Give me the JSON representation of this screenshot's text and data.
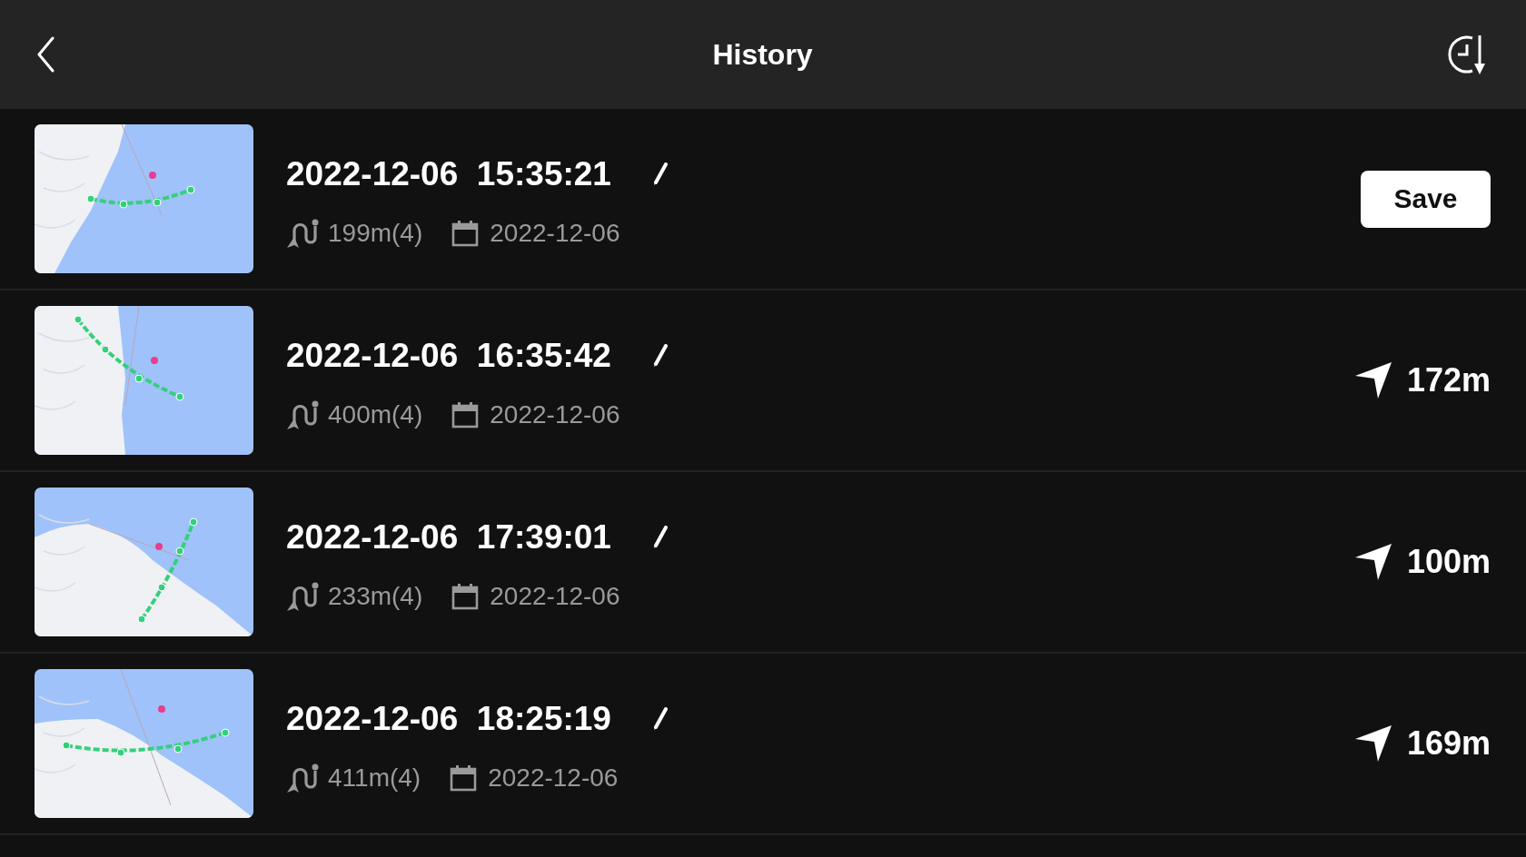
{
  "header": {
    "title": "History"
  },
  "records": [
    {
      "title": "2022-12-06  15:35:21",
      "route": "199m(4)",
      "date": "2022-12-06",
      "action": {
        "kind": "button",
        "label": "Save"
      }
    },
    {
      "title": "2022-12-06  16:35:42",
      "route": "400m(4)",
      "date": "2022-12-06",
      "action": {
        "kind": "distance",
        "label": "172m"
      }
    },
    {
      "title": "2022-12-06  17:39:01",
      "route": "233m(4)",
      "date": "2022-12-06",
      "action": {
        "kind": "distance",
        "label": "100m"
      }
    },
    {
      "title": "2022-12-06  18:25:19",
      "route": "411m(4)",
      "date": "2022-12-06",
      "action": {
        "kind": "distance",
        "label": "169m"
      }
    }
  ]
}
